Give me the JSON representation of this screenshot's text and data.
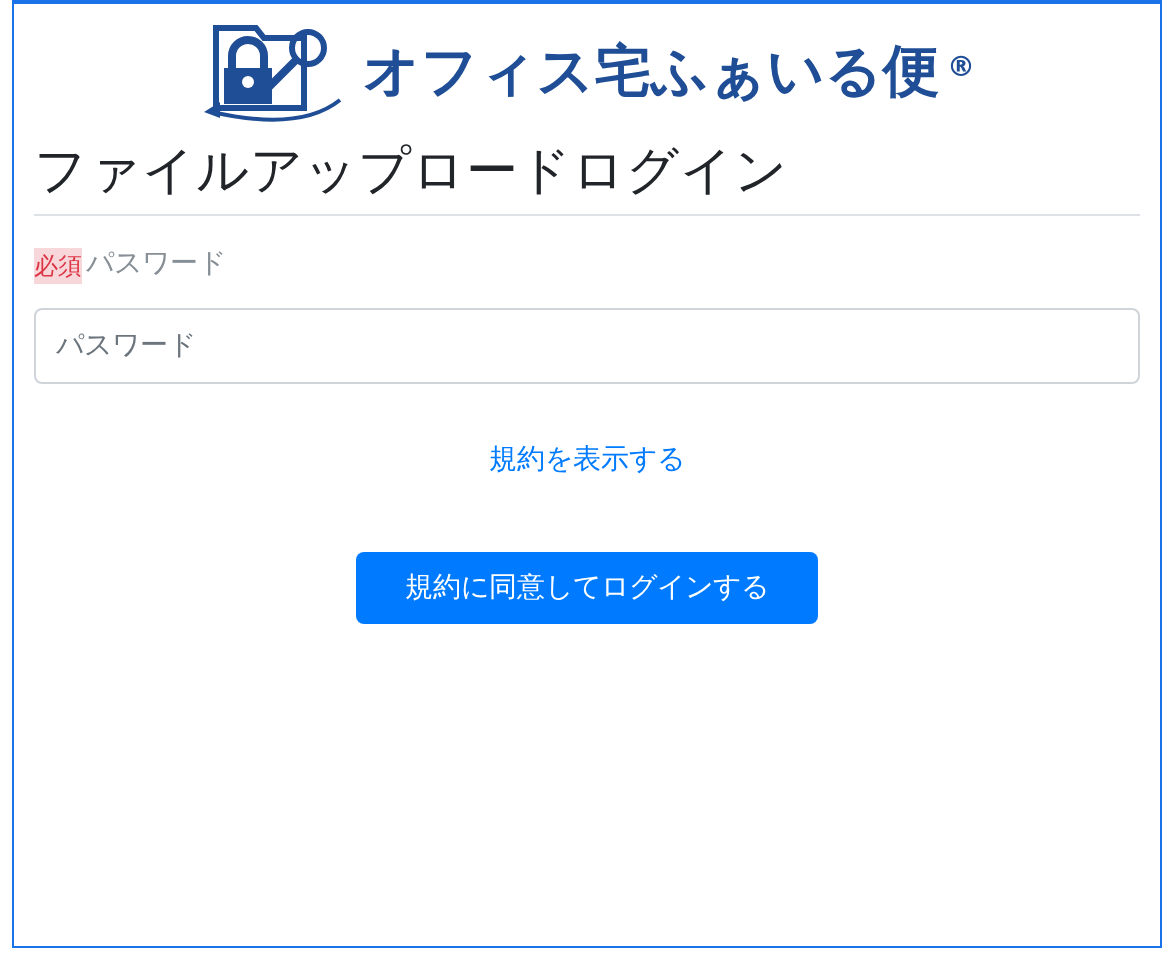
{
  "logo": {
    "name": "オフィス宅ふぁいる便",
    "mark": "®"
  },
  "title": "ファイルアップロードログイン",
  "password": {
    "required_badge": "必須",
    "label": "パスワード",
    "placeholder": "パスワード"
  },
  "terms_link": "規約を表示する",
  "submit_button": "規約に同意してログインする"
}
